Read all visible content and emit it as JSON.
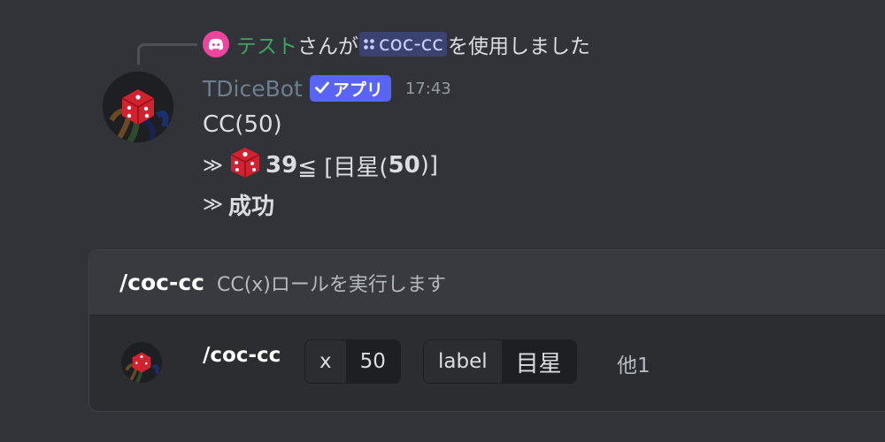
{
  "reply": {
    "user": "テスト",
    "text_before": "さんが",
    "command": "coc-cc",
    "text_after": "を使用しました",
    "icon": "discord-icon"
  },
  "message": {
    "username": "TDiceBot",
    "app_tag": "アプリ",
    "timestamp": "17:43",
    "line1": "CC(50)",
    "line2": {
      "arrow": "≫",
      "icon": "dice-icon",
      "value": "39",
      "text": " ≦ [目星(",
      "bold_num": "50",
      "close": ")]"
    },
    "line3": {
      "arrow": "≫",
      "result": "成功"
    }
  },
  "embed": {
    "command": "/coc-cc",
    "description": "CC(x)ロールを実行します",
    "body_command": "/coc-cc",
    "options": [
      {
        "key": "x",
        "value": "50"
      },
      {
        "key": "label",
        "value": "目星"
      }
    ],
    "more": "他1"
  },
  "colors": {
    "background": "#313338",
    "accent": "#5865f2",
    "reply_user": "#3ba55c",
    "username": "#6d7f8c"
  }
}
